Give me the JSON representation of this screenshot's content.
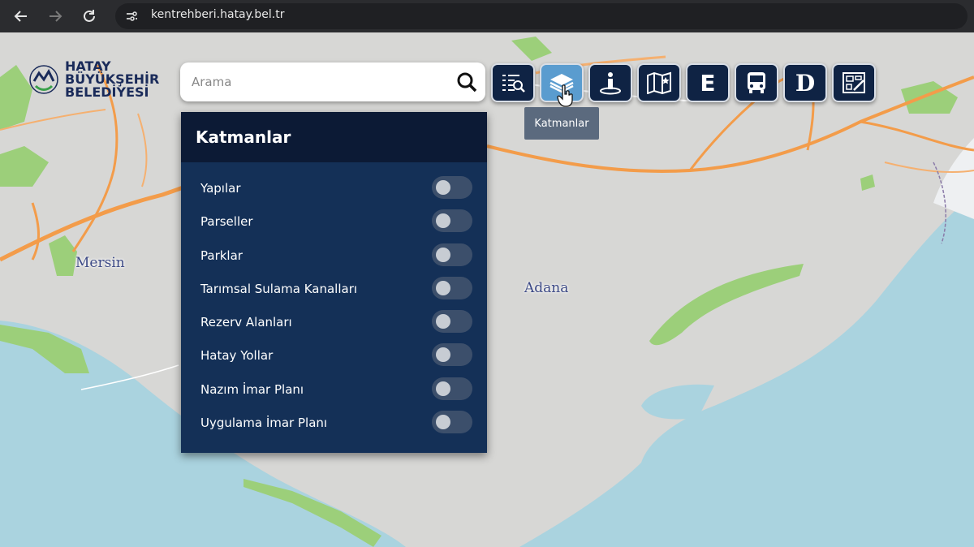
{
  "browser": {
    "url": "kentrehberi.hatay.bel.tr"
  },
  "logo": {
    "line1": "HATAY",
    "line2": "BÜYÜKŞEHİR",
    "line3": "BELEDİYESİ"
  },
  "search": {
    "placeholder": "Arama"
  },
  "toolbar": {
    "buttons": [
      {
        "name": "search-list",
        "icon": "list-search-icon"
      },
      {
        "name": "layers",
        "icon": "layers-icon",
        "active": true
      },
      {
        "name": "info",
        "icon": "info-pin-icon"
      },
      {
        "name": "map-star",
        "icon": "map-star-icon"
      },
      {
        "name": "e",
        "label": "E"
      },
      {
        "name": "bus",
        "icon": "bus-icon"
      },
      {
        "name": "d",
        "label": "D"
      },
      {
        "name": "plan",
        "icon": "plan-icon"
      }
    ],
    "tooltip": "Katmanlar"
  },
  "panel": {
    "title": "Katmanlar",
    "layers": [
      {
        "label": "Yapılar",
        "enabled": false
      },
      {
        "label": "Parseller",
        "enabled": false
      },
      {
        "label": "Parklar",
        "enabled": false
      },
      {
        "label": "Tarımsal Sulama Kanalları",
        "enabled": false
      },
      {
        "label": "Rezerv Alanları",
        "enabled": false
      },
      {
        "label": "Hatay Yollar",
        "enabled": false
      },
      {
        "label": "Nazım İmar Planı",
        "enabled": false
      },
      {
        "label": "Uygulama İmar Planı",
        "enabled": false
      }
    ]
  },
  "map": {
    "labels": {
      "mersin": "Mersin",
      "adana": "Adana"
    }
  },
  "colors": {
    "panel_bg": "#143057",
    "panel_header": "#0c1a35",
    "active_button": "#5a9ccf",
    "sea": "#aad3df",
    "land": "#d7d7d5",
    "road": "#f39c4a",
    "green": "#9ccf7a"
  }
}
